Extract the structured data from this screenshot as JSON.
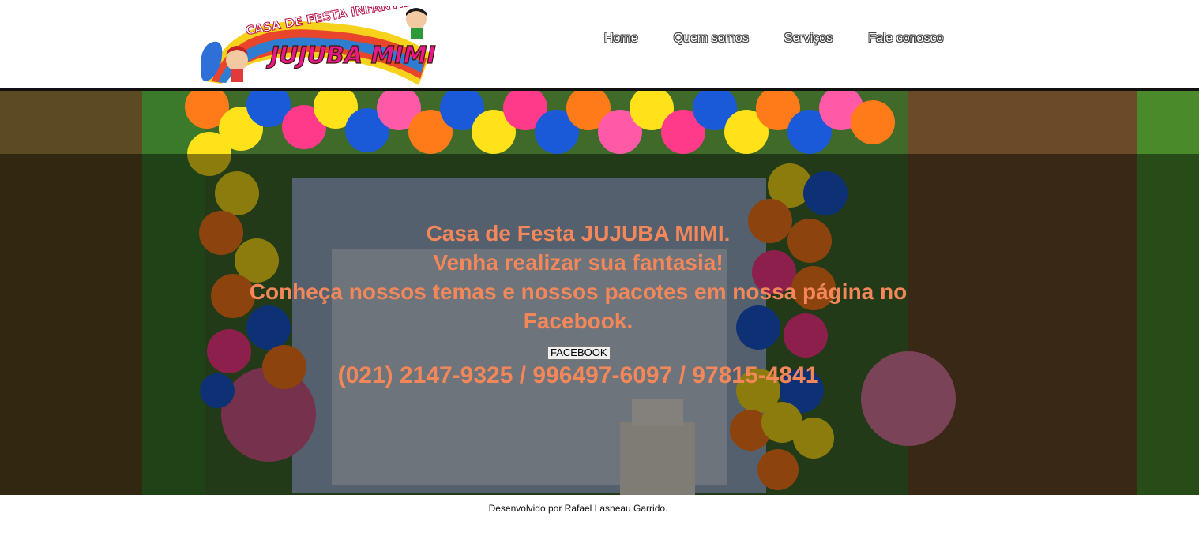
{
  "header": {
    "logo": {
      "top_text": "CASA DE FESTA INFANTIL",
      "main_text": "JUJUBA MIMI"
    },
    "nav": [
      {
        "label": "Home"
      },
      {
        "label": "Quem somos"
      },
      {
        "label": "Serviços"
      },
      {
        "label": "Fale conosco"
      }
    ]
  },
  "hero": {
    "lines": [
      "Casa de Festa JUJUBA MIMI.",
      "Venha realizar sua fantasia!",
      "Conheça nossos temas e nossos pacotes em nossa página no",
      "Facebook."
    ],
    "facebook_button": "FACEBOOK",
    "phones": "(021) 2147-9325 / 996497-6097 / 97815-4841"
  },
  "footer": {
    "credit": "Desenvolvido por Rafael Lasneau Garrido."
  },
  "colors": {
    "accent_text": "#f4875a",
    "header_rule": "#111111"
  }
}
